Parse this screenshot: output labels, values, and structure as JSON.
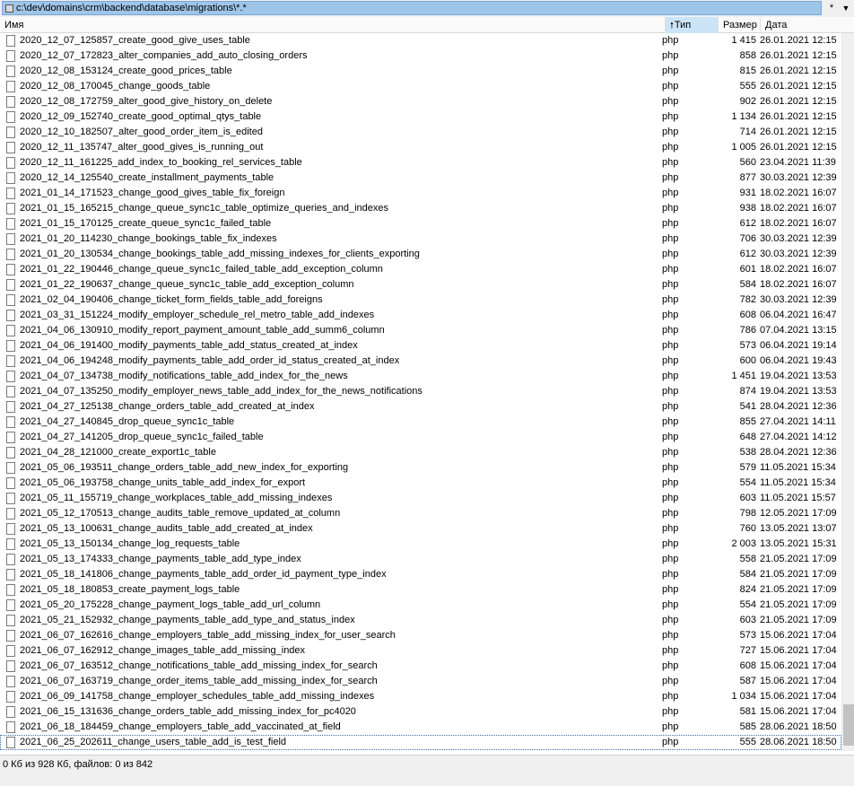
{
  "path": {
    "text": "c:\\dev\\domains\\crm\\backend\\database\\migrations\\*.*",
    "filter_label": "*",
    "dropdown_label": "▼"
  },
  "columns": {
    "name": "Имя",
    "type": "Тип",
    "size": "Размер",
    "date": "Дата",
    "sort_arrow": "🠕"
  },
  "files": [
    {
      "name": "2020_12_07_125857_create_good_give_uses_table",
      "type": "php",
      "size": "1 415",
      "date": "26.01.2021 12:15"
    },
    {
      "name": "2020_12_07_172823_alter_companies_add_auto_closing_orders",
      "type": "php",
      "size": "858",
      "date": "26.01.2021 12:15"
    },
    {
      "name": "2020_12_08_153124_create_good_prices_table",
      "type": "php",
      "size": "815",
      "date": "26.01.2021 12:15"
    },
    {
      "name": "2020_12_08_170045_change_goods_table",
      "type": "php",
      "size": "555",
      "date": "26.01.2021 12:15"
    },
    {
      "name": "2020_12_08_172759_alter_good_give_history_on_delete",
      "type": "php",
      "size": "902",
      "date": "26.01.2021 12:15"
    },
    {
      "name": "2020_12_09_152740_create_good_optimal_qtys_table",
      "type": "php",
      "size": "1 134",
      "date": "26.01.2021 12:15"
    },
    {
      "name": "2020_12_10_182507_alter_good_order_item_is_edited",
      "type": "php",
      "size": "714",
      "date": "26.01.2021 12:15"
    },
    {
      "name": "2020_12_11_135747_alter_good_gives_is_running_out",
      "type": "php",
      "size": "1 005",
      "date": "26.01.2021 12:15"
    },
    {
      "name": "2020_12_11_161225_add_index_to_booking_rel_services_table",
      "type": "php",
      "size": "560",
      "date": "23.04.2021 11:39"
    },
    {
      "name": "2020_12_14_125540_create_installment_payments_table",
      "type": "php",
      "size": "877",
      "date": "30.03.2021 12:39"
    },
    {
      "name": "2021_01_14_171523_change_good_gives_table_fix_foreign",
      "type": "php",
      "size": "931",
      "date": "18.02.2021 16:07"
    },
    {
      "name": "2021_01_15_165215_change_queue_sync1c_table_optimize_queries_and_indexes",
      "type": "php",
      "size": "938",
      "date": "18.02.2021 16:07"
    },
    {
      "name": "2021_01_15_170125_create_queue_sync1c_failed_table",
      "type": "php",
      "size": "612",
      "date": "18.02.2021 16:07"
    },
    {
      "name": "2021_01_20_114230_change_bookings_table_fix_indexes",
      "type": "php",
      "size": "706",
      "date": "30.03.2021 12:39"
    },
    {
      "name": "2021_01_20_130534_change_bookings_table_add_missing_indexes_for_clients_exporting",
      "type": "php",
      "size": "612",
      "date": "30.03.2021 12:39"
    },
    {
      "name": "2021_01_22_190446_change_queue_sync1c_failed_table_add_exception_column",
      "type": "php",
      "size": "601",
      "date": "18.02.2021 16:07"
    },
    {
      "name": "2021_01_22_190637_change_queue_sync1c_table_add_exception_column",
      "type": "php",
      "size": "584",
      "date": "18.02.2021 16:07"
    },
    {
      "name": "2021_02_04_190406_change_ticket_form_fields_table_add_foreigns",
      "type": "php",
      "size": "782",
      "date": "30.03.2021 12:39"
    },
    {
      "name": "2021_03_31_151224_modify_employer_schedule_rel_metro_table_add_indexes",
      "type": "php",
      "size": "608",
      "date": "06.04.2021 16:47"
    },
    {
      "name": "2021_04_06_130910_modify_report_payment_amount_table_add_summ6_column",
      "type": "php",
      "size": "786",
      "date": "07.04.2021 13:15"
    },
    {
      "name": "2021_04_06_191400_modify_payments_table_add_status_created_at_index",
      "type": "php",
      "size": "573",
      "date": "06.04.2021 19:14"
    },
    {
      "name": "2021_04_06_194248_modify_payments_table_add_order_id_status_created_at_index",
      "type": "php",
      "size": "600",
      "date": "06.04.2021 19:43"
    },
    {
      "name": "2021_04_07_134738_modify_notifications_table_add_index_for_the_news",
      "type": "php",
      "size": "1 451",
      "date": "19.04.2021 13:53"
    },
    {
      "name": "2021_04_07_135250_modify_employer_news_table_add_index_for_the_news_notifications",
      "type": "php",
      "size": "874",
      "date": "19.04.2021 13:53"
    },
    {
      "name": "2021_04_27_125138_change_orders_table_add_created_at_index",
      "type": "php",
      "size": "541",
      "date": "28.04.2021 12:36"
    },
    {
      "name": "2021_04_27_140845_drop_queue_sync1c_table",
      "type": "php",
      "size": "855",
      "date": "27.04.2021 14:11"
    },
    {
      "name": "2021_04_27_141205_drop_queue_sync1c_failed_table",
      "type": "php",
      "size": "648",
      "date": "27.04.2021 14:12"
    },
    {
      "name": "2021_04_28_121000_create_export1c_table",
      "type": "php",
      "size": "538",
      "date": "28.04.2021 12:36"
    },
    {
      "name": "2021_05_06_193511_change_orders_table_add_new_index_for_exporting",
      "type": "php",
      "size": "579",
      "date": "11.05.2021 15:34"
    },
    {
      "name": "2021_05_06_193758_change_units_table_add_index_for_export",
      "type": "php",
      "size": "554",
      "date": "11.05.2021 15:34"
    },
    {
      "name": "2021_05_11_155719_change_workplaces_table_add_missing_indexes",
      "type": "php",
      "size": "603",
      "date": "11.05.2021 15:57"
    },
    {
      "name": "2021_05_12_170513_change_audits_table_remove_updated_at_column",
      "type": "php",
      "size": "798",
      "date": "12.05.2021 17:09"
    },
    {
      "name": "2021_05_13_100631_change_audits_table_add_created_at_index",
      "type": "php",
      "size": "760",
      "date": "13.05.2021 13:07"
    },
    {
      "name": "2021_05_13_150134_change_log_requests_table",
      "type": "php",
      "size": "2 003",
      "date": "13.05.2021 15:31"
    },
    {
      "name": "2021_05_13_174333_change_payments_table_add_type_index",
      "type": "php",
      "size": "558",
      "date": "21.05.2021 17:09"
    },
    {
      "name": "2021_05_18_141806_change_payments_table_add_order_id_payment_type_index",
      "type": "php",
      "size": "584",
      "date": "21.05.2021 17:09"
    },
    {
      "name": "2021_05_18_180853_create_payment_logs_table",
      "type": "php",
      "size": "824",
      "date": "21.05.2021 17:09"
    },
    {
      "name": "2021_05_20_175228_change_payment_logs_table_add_url_column",
      "type": "php",
      "size": "554",
      "date": "21.05.2021 17:09"
    },
    {
      "name": "2021_05_21_152932_change_payments_table_add_type_and_status_index",
      "type": "php",
      "size": "603",
      "date": "21.05.2021 17:09"
    },
    {
      "name": "2021_06_07_162616_change_employers_table_add_missing_index_for_user_search",
      "type": "php",
      "size": "573",
      "date": "15.06.2021 17:04"
    },
    {
      "name": "2021_06_07_162912_change_images_table_add_missing_index",
      "type": "php",
      "size": "727",
      "date": "15.06.2021 17:04"
    },
    {
      "name": "2021_06_07_163512_change_notifications_table_add_missing_index_for_search",
      "type": "php",
      "size": "608",
      "date": "15.06.2021 17:04"
    },
    {
      "name": "2021_06_07_163719_change_order_items_table_add_missing_index_for_search",
      "type": "php",
      "size": "587",
      "date": "15.06.2021 17:04"
    },
    {
      "name": "2021_06_09_141758_change_employer_schedules_table_add_missing_indexes",
      "type": "php",
      "size": "1 034",
      "date": "15.06.2021 17:04"
    },
    {
      "name": "2021_06_15_131636_change_orders_table_add_missing_index_for_pc4020",
      "type": "php",
      "size": "581",
      "date": "15.06.2021 17:04"
    },
    {
      "name": "2021_06_18_184459_change_employers_table_add_vaccinated_at_field",
      "type": "php",
      "size": "585",
      "date": "28.06.2021 18:50"
    },
    {
      "name": "2021_06_25_202611_change_users_table_add_is_test_field",
      "type": "php",
      "size": "555",
      "date": "28.06.2021 18:50",
      "selected": true
    }
  ],
  "status": {
    "text": "0 Кб из 928 Кб, файлов: 0 из 842"
  }
}
